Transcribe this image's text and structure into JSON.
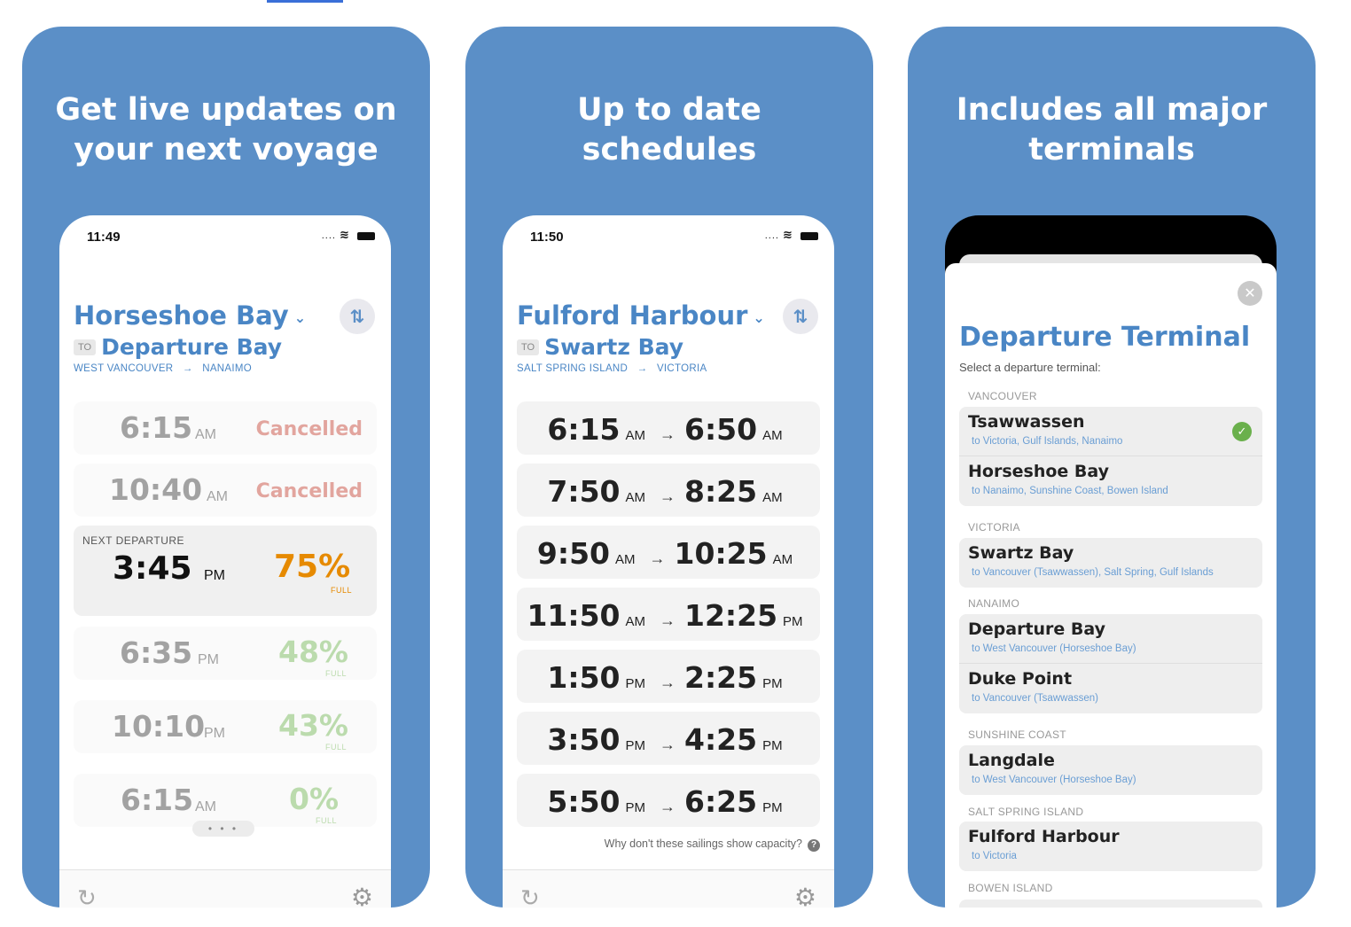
{
  "colors": {
    "card_blue": "#5b8fc7",
    "accent_blue": "#4a86c5",
    "cancelled_red": "#c0392b",
    "capacity_orange": "#e68a00",
    "capacity_green": "#6ab04c",
    "check_green": "#6ab04c"
  },
  "panel1": {
    "title_line1": "Get live updates on",
    "title_line2": "your next voyage",
    "status_time": "11:49",
    "route": {
      "from": "Horseshoe Bay",
      "to_badge": "TO",
      "to": "Departure Bay",
      "from_city": "WEST VANCOUVER",
      "to_city": "NANAIMO"
    },
    "sailings": [
      {
        "time": "6:15",
        "ampm": "AM",
        "status": "Cancelled"
      },
      {
        "time": "10:40",
        "ampm": "AM",
        "status": "Cancelled"
      }
    ],
    "next": {
      "label": "NEXT DEPARTURE",
      "time": "3:45",
      "ampm": "PM",
      "percent": "75%",
      "full": "FULL"
    },
    "upcoming": [
      {
        "time": "6:35",
        "ampm": "PM",
        "percent": "48%",
        "full": "FULL"
      },
      {
        "time": "10:10",
        "ampm": "PM",
        "percent": "43%",
        "full": "FULL"
      },
      {
        "time": "6:15",
        "ampm": "AM",
        "percent": "0%",
        "full": "FULL"
      }
    ],
    "page_dots": "• • •"
  },
  "panel2": {
    "title_line1": "Up to date",
    "title_line2": "schedules",
    "status_time": "11:50",
    "route": {
      "from": "Fulford Harbour",
      "to_badge": "TO",
      "to": "Swartz Bay",
      "from_city": "SALT SPRING ISLAND",
      "to_city": "VICTORIA"
    },
    "schedule": [
      {
        "dep": "6:15",
        "dep_ampm": "AM",
        "arr": "6:50",
        "arr_ampm": "AM"
      },
      {
        "dep": "7:50",
        "dep_ampm": "AM",
        "arr": "8:25",
        "arr_ampm": "AM"
      },
      {
        "dep": "9:50",
        "dep_ampm": "AM",
        "arr": "10:25",
        "arr_ampm": "AM"
      },
      {
        "dep": "11:50",
        "dep_ampm": "AM",
        "arr": "12:25",
        "arr_ampm": "PM"
      },
      {
        "dep": "1:50",
        "dep_ampm": "PM",
        "arr": "2:25",
        "arr_ampm": "PM"
      },
      {
        "dep": "3:50",
        "dep_ampm": "PM",
        "arr": "4:25",
        "arr_ampm": "PM"
      },
      {
        "dep": "5:50",
        "dep_ampm": "PM",
        "arr": "6:25",
        "arr_ampm": "PM"
      }
    ],
    "capacity_question": "Why don't these sailings show capacity?"
  },
  "panel3": {
    "title_line1": "Includes all major",
    "title_line2": "terminals",
    "sheet_title": "Departure Terminal",
    "sheet_subtitle": "Select a departure terminal:",
    "sections": [
      {
        "label": "VANCOUVER",
        "terminals": [
          {
            "name": "Tsawwassen",
            "sub": "to Victoria, Gulf Islands, Nanaimo",
            "selected": true
          },
          {
            "name": "Horseshoe Bay",
            "sub": "to Nanaimo, Sunshine Coast, Bowen Island"
          }
        ]
      },
      {
        "label": "VICTORIA",
        "terminals": [
          {
            "name": "Swartz Bay",
            "sub": "to Vancouver (Tsawwassen), Salt Spring, Gulf Islands"
          }
        ]
      },
      {
        "label": "NANAIMO",
        "terminals": [
          {
            "name": "Departure Bay",
            "sub": "to West Vancouver (Horseshoe Bay)"
          },
          {
            "name": "Duke Point",
            "sub": "to Vancouver (Tsawwassen)"
          }
        ]
      },
      {
        "label": "SUNSHINE COAST",
        "terminals": [
          {
            "name": "Langdale",
            "sub": "to West Vancouver (Horseshoe Bay)"
          }
        ]
      },
      {
        "label": "SALT SPRING ISLAND",
        "terminals": [
          {
            "name": "Fulford Harbour",
            "sub": "to Victoria"
          }
        ]
      },
      {
        "label": "BOWEN ISLAND",
        "terminals": []
      }
    ]
  }
}
